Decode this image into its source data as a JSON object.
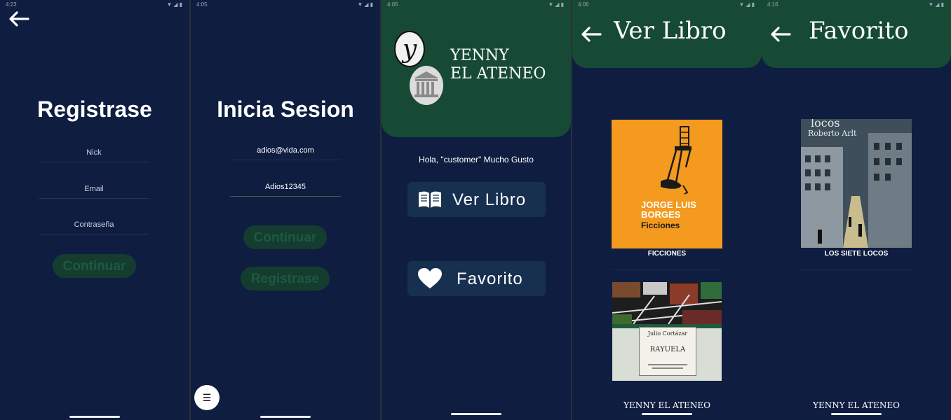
{
  "status_times": [
    "4:23",
    "4:05",
    "4:05",
    "4:06",
    "4:16"
  ],
  "register": {
    "title": "Registrase",
    "fields": [
      {
        "label": "Nick"
      },
      {
        "label": "Email"
      },
      {
        "label": "Contraseña"
      }
    ],
    "continue_label": "Continuar"
  },
  "login": {
    "title": "Inicia Sesion",
    "email_value": "adios@vida.com",
    "password_value": "Adios12345",
    "continue_label": "Continuar",
    "register_label": "Registrase"
  },
  "home": {
    "brand_line1": "YENNY",
    "brand_line2": "EL ATENEO",
    "greeting": "Hola, \"customer\" Mucho Gusto",
    "buttons": {
      "ver_libro": "Ver Libro",
      "favorito": "Favorito"
    }
  },
  "ver_libro": {
    "title": "Ver Libro",
    "books": [
      {
        "caption": "FICCIONES",
        "cover_author_line1": "JORGE LUIS",
        "cover_author_line2": "BORGES",
        "cover_title": "Ficciones"
      },
      {
        "caption": "",
        "cover_author": "Julio Cortázar",
        "cover_title": "RAYUELA"
      }
    ],
    "footer": "YENNY EL ATENEO"
  },
  "favorito": {
    "title": "Favorito",
    "books": [
      {
        "caption": "LOS SIETE LOCOS",
        "cover_title_fragment": "locos",
        "cover_author": "Roberto Arlt"
      }
    ],
    "footer": "YENNY EL ATENEO"
  },
  "colors": {
    "background": "#0f1d40",
    "header_green": "#174a35",
    "button_green": "#143d2f",
    "menu_button": "#17304f"
  }
}
